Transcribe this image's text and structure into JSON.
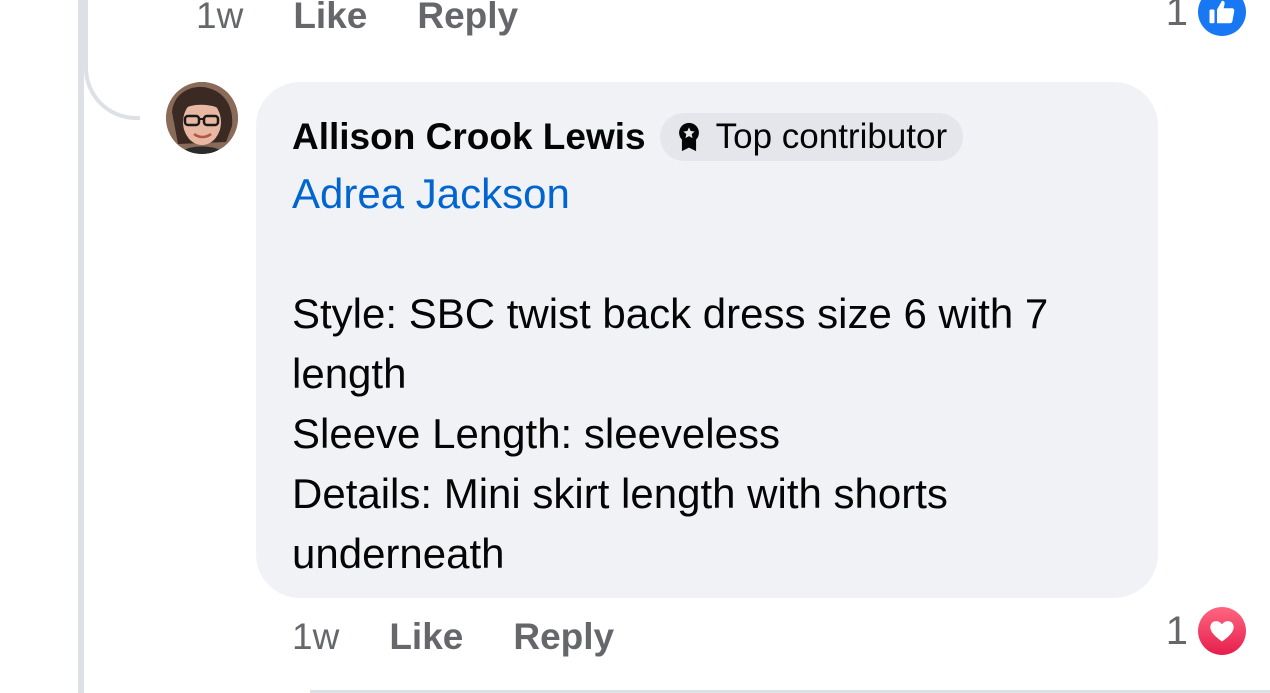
{
  "prev_comment": {
    "time": "1w",
    "like_label": "Like",
    "reply_label": "Reply",
    "reaction_count": "1",
    "reaction_icon": "like-thumb-icon"
  },
  "comment": {
    "author": "Allison Crook Lewis",
    "badge_label": "Top contributor",
    "badge_icon": "top-contributor-badge-icon",
    "mention": "Adrea Jackson",
    "lines": [
      "Style: SBC twist back dress size 6 with 7",
      "length",
      "Sleeve Length: sleeveless",
      "Details: Mini skirt length with shorts",
      "underneath"
    ],
    "time": "1w",
    "like_label": "Like",
    "reply_label": "Reply",
    "reaction_count": "1",
    "reaction_icon": "love-heart-icon"
  },
  "colors": {
    "bubble_bg": "#f0f2f5",
    "mention": "#0064d1",
    "like_blue": "#1877f2",
    "love_red": "#f33e58",
    "meta_gray": "#65676b"
  }
}
